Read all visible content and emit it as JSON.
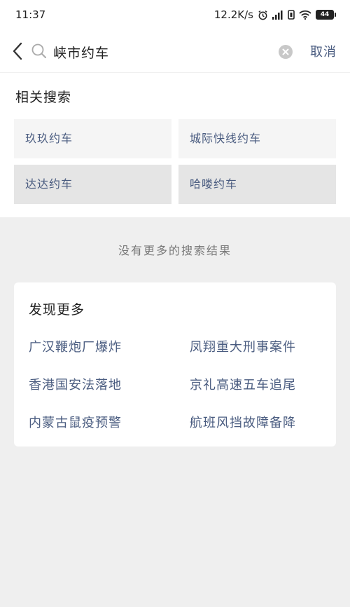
{
  "status_bar": {
    "time": "11:37",
    "network_speed": "12.2K/s",
    "battery": "44",
    "icons": [
      "alarm-icon",
      "signal-icon",
      "vibrate-icon",
      "wifi-icon",
      "battery-icon"
    ]
  },
  "search": {
    "query": "峡市约车",
    "cancel_label": "取消"
  },
  "related": {
    "title": "相关搜索",
    "items": [
      {
        "label": "玖玖约车"
      },
      {
        "label": "城际快线约车"
      },
      {
        "label": "达达约车"
      },
      {
        "label": "哈喽约车"
      }
    ]
  },
  "no_more_text": "没有更多的搜索结果",
  "discover": {
    "title": "发现更多",
    "topics": [
      {
        "label": "广汉鞭炮厂爆炸"
      },
      {
        "label": "凤翔重大刑事案件"
      },
      {
        "label": "香港国安法落地"
      },
      {
        "label": "京礼高速五车追尾"
      },
      {
        "label": "内蒙古鼠疫预警"
      },
      {
        "label": "航班风挡故障备降"
      }
    ]
  },
  "colors": {
    "link": "#4a5c80",
    "page_bg": "#efefef",
    "chip_bg": "#f5f5f5"
  }
}
